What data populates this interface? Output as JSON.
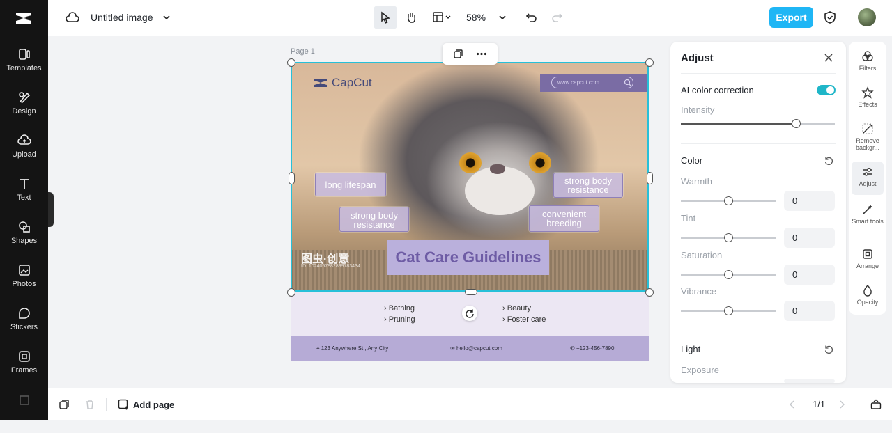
{
  "app": {
    "title": "Untitled image",
    "zoom": "58%",
    "export_label": "Export"
  },
  "left_rail": {
    "items": [
      {
        "label": "Templates",
        "icon": "templates-icon"
      },
      {
        "label": "Design",
        "icon": "design-icon"
      },
      {
        "label": "Upload",
        "icon": "upload-icon"
      },
      {
        "label": "Text",
        "icon": "text-icon"
      },
      {
        "label": "Shapes",
        "icon": "shapes-icon"
      },
      {
        "label": "Photos",
        "icon": "photos-icon"
      },
      {
        "label": "Stickers",
        "icon": "stickers-icon"
      },
      {
        "label": "Frames",
        "icon": "frames-icon"
      }
    ]
  },
  "canvas": {
    "page_label": "Page 1",
    "design": {
      "brand": "CapCut",
      "url": "www.capcut.com",
      "tags": [
        "long lifespan",
        "strong body resistance",
        "strong body resistance",
        "convenient breeding"
      ],
      "title": "Cat Care Guidelines",
      "watermark": "图虫·创意",
      "watermark_id": "ID: 1024057882899783434",
      "list_left": [
        "Bathing",
        "Pruning"
      ],
      "list_right": [
        "Beauty",
        "Foster care"
      ],
      "footer": {
        "address": "123 Anywhere St., Any City",
        "email": "hello@capcut.com",
        "phone": "+123-456-7890"
      }
    }
  },
  "bottom": {
    "add_page": "Add page",
    "page_counter": "1/1"
  },
  "adjust_panel": {
    "title": "Adjust",
    "ai_color_correction": {
      "label": "AI color correction",
      "enabled": true,
      "intensity_label": "Intensity",
      "intensity": 0.75
    },
    "color": {
      "label": "Color",
      "sliders": [
        {
          "label": "Warmth",
          "value": "0"
        },
        {
          "label": "Tint",
          "value": "0"
        },
        {
          "label": "Saturation",
          "value": "0"
        },
        {
          "label": "Vibrance",
          "value": "0"
        }
      ]
    },
    "light": {
      "label": "Light",
      "exposure_label": "Exposure"
    }
  },
  "right_rail": {
    "items": [
      {
        "label": "Filters"
      },
      {
        "label": "Effects"
      },
      {
        "label": "Remove backgr..."
      },
      {
        "label": "Adjust",
        "selected": true
      },
      {
        "label": "Smart tools"
      },
      {
        "label": "Arrange"
      },
      {
        "label": "Opacity"
      }
    ]
  },
  "colors": {
    "accent": "#1fb6f5",
    "selection": "#27c0d8",
    "theme_purple": "#b6abd6"
  }
}
